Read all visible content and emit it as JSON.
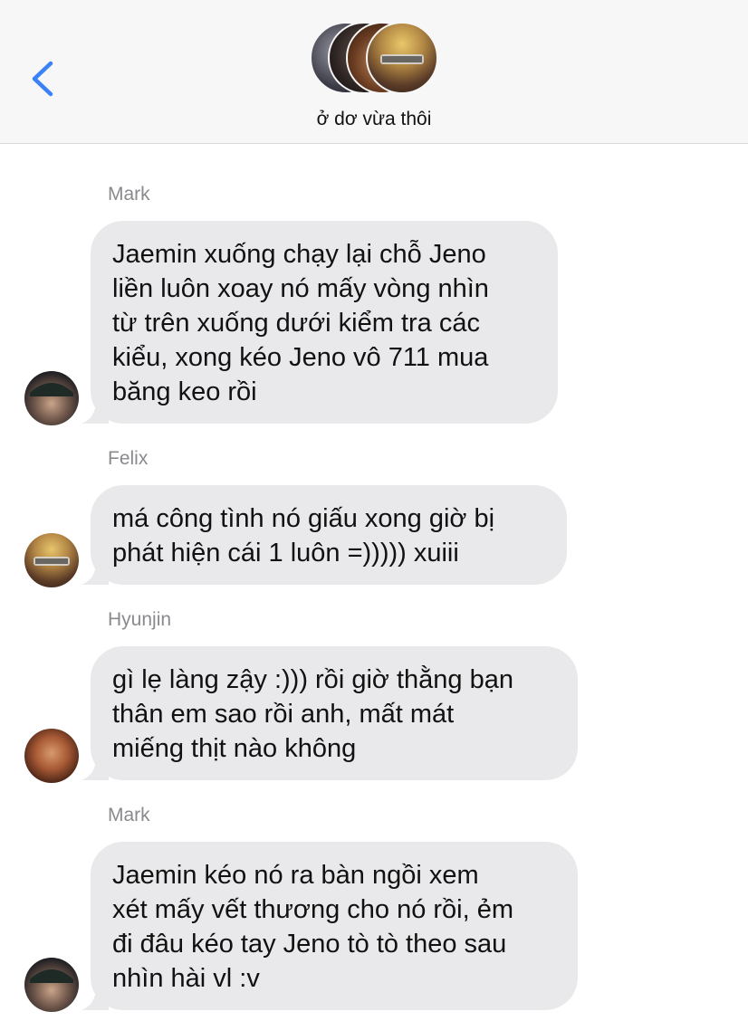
{
  "header": {
    "group_name": "ở dơ vừa thôi",
    "back_icon": "chevron-left-icon",
    "accent_color": "#3b82f6"
  },
  "messages": [
    {
      "sender": "Mark",
      "lines": [
        "Jaemin xuống chạy lại chỗ Jeno",
        "liền luôn xoay nó mấy vòng nhìn",
        "từ trên xuống dưới kiểm tra các",
        "kiểu, xong kéo Jeno vô 711 mua",
        "băng keo rồi"
      ]
    },
    {
      "sender": "Felix",
      "lines": [
        "má công tình nó giấu xong giờ bị",
        "phát hiện cái 1 luôn =))))) xuiii"
      ]
    },
    {
      "sender": "Hyunjin",
      "lines": [
        "gì lẹ làng zậy :))) rồi giờ thằng bạn",
        "thân em sao rồi anh, mất mát",
        "miếng thịt nào không"
      ]
    },
    {
      "sender": "Mark",
      "lines": [
        "Jaemin kéo nó ra bàn ngồi xem",
        "xét mấy vết thương cho nó rồi, ẻm",
        "đi đâu kéo tay Jeno tò tò theo sau",
        "nhìn hài vl :v"
      ]
    }
  ],
  "colors": {
    "bubble_incoming": "#e9e9eb",
    "sender_label": "#8a8a8e",
    "header_bg": "#f7f7f7"
  }
}
